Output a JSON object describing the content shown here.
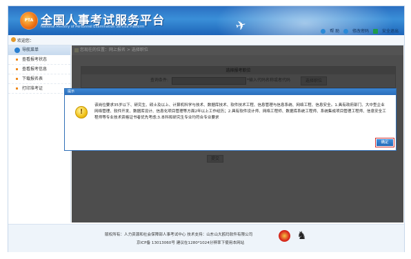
{
  "header": {
    "logo_text": "PTA",
    "title": "全国人事考试服务平台",
    "subtitle": "National Ministry of Personnel Examination Service Platform",
    "links": {
      "help": "帮 助",
      "change_password": "修改密码",
      "logout": "安全退出"
    }
  },
  "welcome": {
    "text": "欢迎您："
  },
  "sidebar": {
    "header": "导航菜单",
    "items": [
      {
        "label": "查看报考状态"
      },
      {
        "label": "查看报考信息"
      },
      {
        "label": "下载报名表"
      },
      {
        "label": "打印准考证"
      }
    ]
  },
  "main": {
    "breadcrumb": "您现在的位置：网上报名 > 选择职位",
    "panel_title": "选择报考职位",
    "query_label": "查询条件:",
    "query_value": "",
    "query_hint": "*输入代码名称或者代码",
    "select_button": "选择职位",
    "submit_button": "提交"
  },
  "dialog": {
    "title": "提示",
    "message": "该岗位要求35岁以下、研究生、硕士及以上、计算机科学与技术、数据库技术、软件技术工程、信息管理与信息系统、网络工程、信息安全。1.具有政府部门、大中型企业网络管理、软件开发、数据库设计、信息化项目管理等方面2年以上工作经历；2.具有软件设计师、网络工程师、数据库系统工程师、系统集成项目管理工程师、信息安全工程师等专业技术资格证书者优先考虑;3.本科和研究生专业均符合专业要求",
    "ok_label": "确定"
  },
  "footer": {
    "line1": "版权所有：人力资源和社会保障部人事考试中心  技术支持：山东山大鸥玛软件有限公司",
    "line2": "京ICP备 13013060号  建议在1280*1024分辨率下使用本网站"
  },
  "colors": {
    "header_blue": "#2a6fc1",
    "accent_orange": "#f08a1c",
    "dialog_title": "#2a6dbb",
    "ok_outline": "#d03030"
  }
}
